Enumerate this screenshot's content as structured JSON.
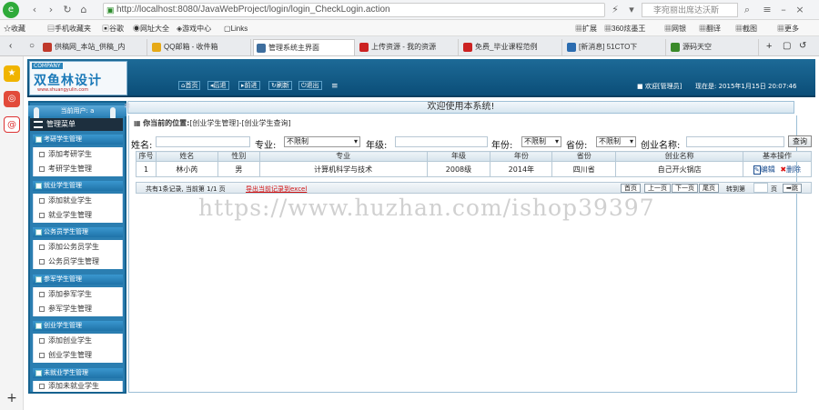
{
  "browser": {
    "favorites": "收藏",
    "url": "http://localhost:8080/JavaWebProject/login/login_CheckLogin.action",
    "search_placeholder": "李宛丽出席达沃斯",
    "toolbar_right": [
      "扩展",
      "360炫墨王",
      "网银",
      "翻译",
      "截图",
      "更多"
    ],
    "bookmarks": [
      "手机收藏夹",
      "谷歌",
      "网址大全",
      "游戏中心",
      "Links"
    ],
    "tabs": [
      {
        "label": "供稿网_本站_供稿_内",
        "color": "#c0392b"
      },
      {
        "label": "QQ邮箱 - 收件箱",
        "color": "#e6a917"
      },
      {
        "label": "管理系统主界面",
        "color": "#3e6e9e",
        "active": true
      },
      {
        "label": "上传资源 - 我的资源",
        "color": "#cc2222"
      },
      {
        "label": "免费_毕业课程范例",
        "color": "#cc2222"
      },
      {
        "label": "[新消息] 51CTO下",
        "color": "#2b6cb0"
      },
      {
        "label": "源码天空",
        "color": "#3a8a2a"
      }
    ]
  },
  "header": {
    "company": "COMPANY",
    "logo_text": "双鱼林设计",
    "logo_url": "www.shuangyulin.com",
    "nav": [
      "首页",
      "后退",
      "前进",
      "刷新",
      "退出"
    ],
    "welcome": "欢迎[管理员]",
    "time_label": "现在是:",
    "time_value": "2015年1月15日 20:07:46"
  },
  "welcome_msg": "欢迎使用本系统!",
  "sidebar": {
    "current_user": "当前用户: a",
    "menu_title": "管理菜单",
    "groups": [
      {
        "title": "考研学生管理",
        "items": [
          "添加考研学生",
          "考研学生管理"
        ]
      },
      {
        "title": "就业学生管理",
        "items": [
          "添加就业学生",
          "就业学生管理"
        ]
      },
      {
        "title": "公务员学生管理",
        "items": [
          "添加公务员学生",
          "公务员学生管理"
        ]
      },
      {
        "title": "参军学生管理",
        "items": [
          "添加参军学生",
          "参军学生管理"
        ]
      },
      {
        "title": "创业学生管理",
        "items": [
          "添加创业学生",
          "创业学生管理"
        ]
      },
      {
        "title": "未就业学生管理",
        "items": [
          "添加未就业学生"
        ]
      }
    ]
  },
  "location": {
    "label": "你当前的位置:",
    "path": "[创业学生管理]-[创业学生查询]"
  },
  "filters": {
    "name_label": "姓名:",
    "major_label": "专业:",
    "major_value": "不限制",
    "grade_label": "年级:",
    "year_label": "年份:",
    "year_value": "不限制",
    "province_label": "省份:",
    "province_value": "不限制",
    "biz_label": "创业名称:",
    "query_button": "查询"
  },
  "table": {
    "headers": [
      "序号",
      "姓名",
      "性别",
      "专业",
      "年级",
      "年份",
      "省份",
      "创业名称",
      "基本操作"
    ],
    "rows": [
      [
        "1",
        "林小芮",
        "男",
        "计算机科学与技术",
        "2008级",
        "2014年",
        "四川省",
        "自己开火锅店"
      ]
    ],
    "edit": "编辑",
    "delete": "删除"
  },
  "pager": {
    "summary": "共有1条记录, 当前第 1/1 页",
    "export": "导出当前记录到excel",
    "buttons": [
      "首页",
      "上一页",
      "下一页",
      "尾页"
    ],
    "goto": "转到第",
    "page_unit": "页",
    "go_button": "跳"
  },
  "watermark": "https://www.huzhan.com/ishop39397",
  "colors": {
    "header": "#0b4e78",
    "sidebar": "#2b7eb1",
    "export_link": "#d11111"
  }
}
